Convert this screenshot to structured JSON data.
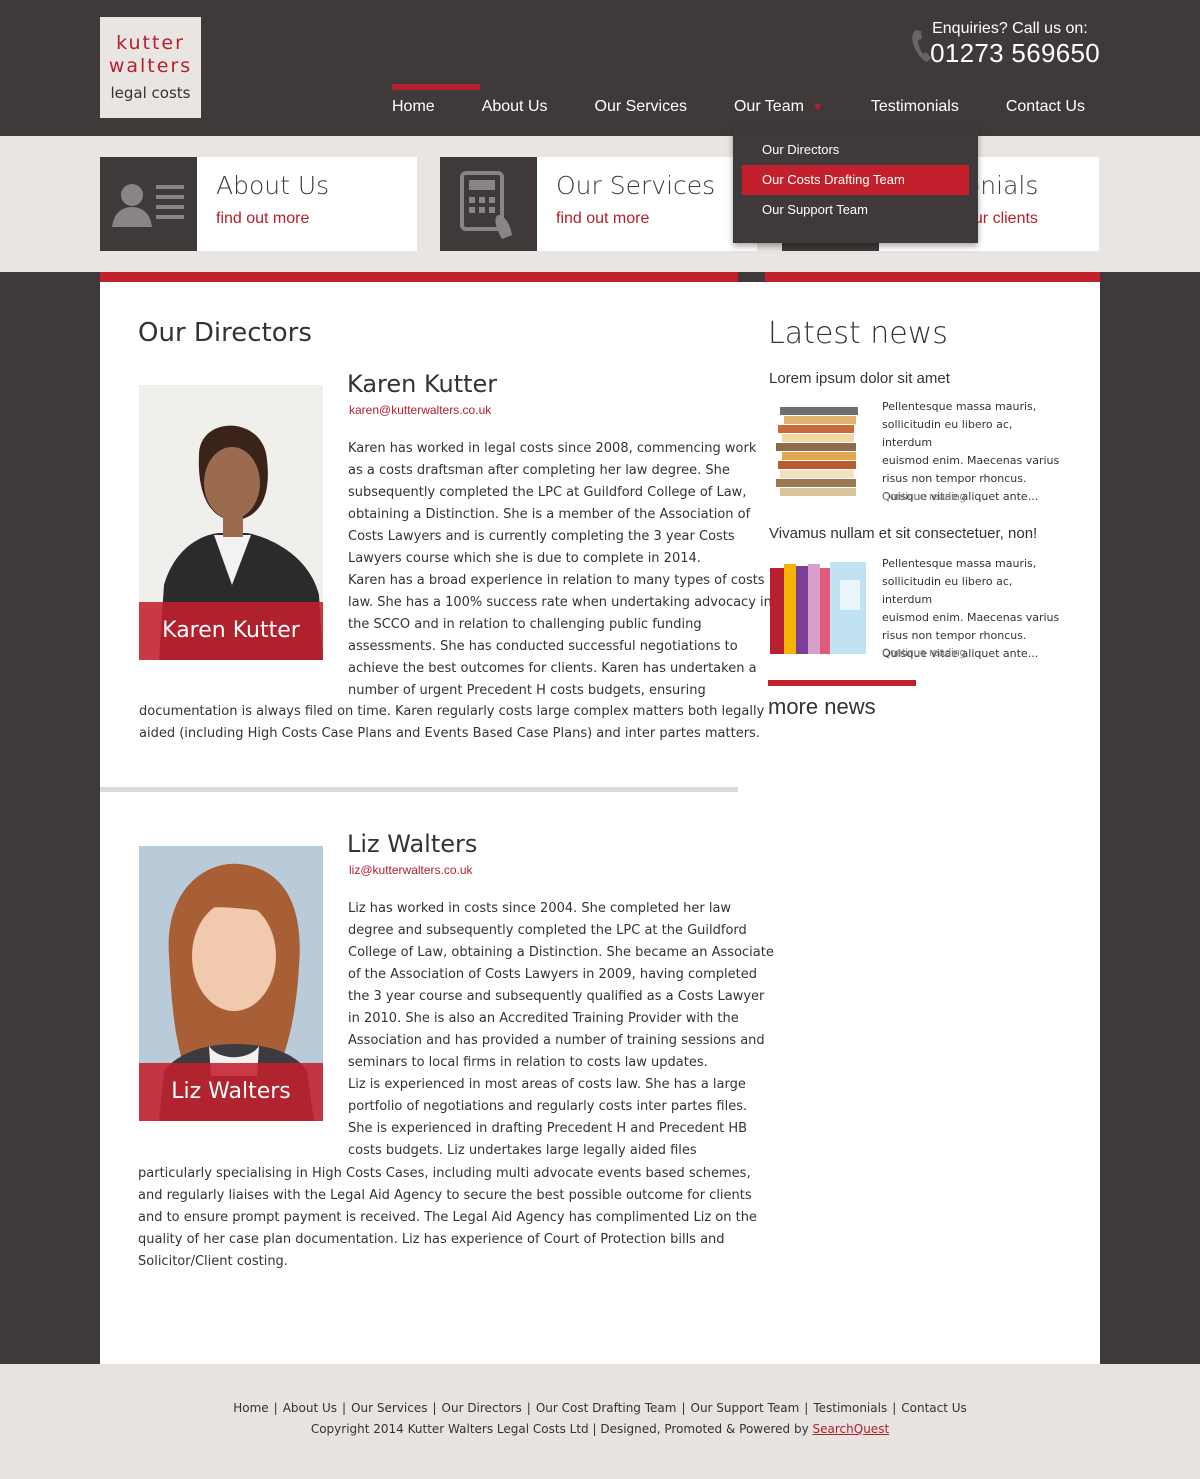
{
  "logo": {
    "line1": "kutter",
    "line2": "walters",
    "line3": "legal costs"
  },
  "header": {
    "enquiries_label": "Enquiries?  Call us on:",
    "phone": "01273 569650"
  },
  "nav": {
    "items": [
      {
        "label": "Home",
        "active": true
      },
      {
        "label": "About Us"
      },
      {
        "label": "Our Services"
      },
      {
        "label": "Our Team",
        "has_dropdown": true
      },
      {
        "label": "Testimonials"
      },
      {
        "label": "Contact Us"
      }
    ]
  },
  "dropdown": {
    "items": [
      {
        "label": "Our Directors"
      },
      {
        "label": "Our Costs Drafting Team",
        "highlighted": true
      },
      {
        "label": "Our Support Team"
      }
    ]
  },
  "features": [
    {
      "title": "About Us",
      "link": "find out more",
      "icon": "person-icon"
    },
    {
      "title": "Our Services",
      "link": "find out more",
      "icon": "calculator-icon"
    },
    {
      "title": "Testimonials",
      "link": "from our clients",
      "icon": "quote-icon",
      "visible_title": "onials",
      "visible_link": "our clients"
    }
  ],
  "main": {
    "heading": "Our Directors",
    "directors": [
      {
        "name": "Karen Kutter",
        "email": "karen@kutterwalters.co.uk",
        "caption": "Karen Kutter",
        "bio_lines": [
          "Karen has worked in legal costs since 2008, commencing work",
          "as a costs draftsman after completing her law degree. She",
          "subsequently completed the LPC at Guildford College of Law,",
          "obtaining a Distinction. She is a member of the Association of",
          "Costs Lawyers and is currently completing the 3 year Costs",
          "Lawyers course which she is due to complete in 2014.",
          "Karen has a broad experience in relation to many types of costs",
          "law. She has a 100% success rate when undertaking advocacy in",
          "the SCCO and in relation to challenging public funding",
          "assessments. She has conducted successful negotiations to",
          "achieve the best outcomes for clients. Karen has undertaken a",
          "number of urgent Precedent H costs budgets, ensuring",
          "documentation is always filed on time. Karen regularly costs large complex matters both legally",
          "aided (including High Costs Case Plans and Events Based Case Plans) and inter partes matters."
        ]
      },
      {
        "name": "Liz Walters",
        "email": "liz@kutterwalters.co.uk",
        "caption": "Liz Walters",
        "bio_lines": [
          "Liz has worked in costs since 2004. She completed her law",
          "degree and subsequently completed the LPC at the Guildford",
          "College of Law, obtaining a Distinction. She became an Associate",
          "of the Association of Costs Lawyers in 2009, having completed",
          "the 3 year course and subsequently qualified as a Costs Lawyer",
          "in 2010. She is also an Accredited Training Provider with the",
          "Association and has provided a number of training sessions and",
          "seminars to local firms in relation to costs law updates.",
          "Liz is experienced in most areas of costs law. She has a large",
          "portfolio of negotiations and regularly costs inter partes files.",
          "She is experienced in drafting Precedent H and Precedent HB",
          "costs budgets. Liz undertakes large legally aided files",
          "particularly specialising in High Costs Cases, including multi advocate events based schemes,",
          "and regularly liaises with the Legal Aid Agency to secure the best possible outcome for clients",
          "and to ensure prompt payment is received. The Legal Aid Agency has complimented Liz on the",
          "quality of her case plan documentation. Liz has experience of Court of Protection bills and",
          "Solicitor/Client costing."
        ]
      }
    ]
  },
  "sidebar": {
    "heading": "Latest news",
    "news": [
      {
        "title": "Lorem ipsum dolor sit amet",
        "text_lines": [
          "Pellentesque massa mauris,",
          "sollicitudin eu libero ac, interdum",
          "euismod enim. Maecenas varius",
          "risus non tempor rhoncus.",
          "Quisque vitae aliquet ante..."
        ],
        "more": "Continue reading",
        "thumb": "books-icon"
      },
      {
        "title": "Vivamus nullam et sit consectetuer, non!",
        "text_lines": [
          "Pellentesque massa mauris,",
          "sollicitudin eu libero ac, interdum",
          "euismod enim. Maecenas varius",
          "risus non tempor rhoncus.",
          "Quisque vitae aliquet ante..."
        ],
        "more": "Continue reading",
        "thumb": "folders-icon"
      }
    ],
    "more_news": "more news"
  },
  "footer": {
    "links": [
      "Home",
      "About Us",
      "Our Services",
      "Our Directors",
      "Our Cost Drafting Team",
      "Our Support Team",
      "Testimonials",
      "Contact Us"
    ],
    "copyright": "Copyright 2014 Kutter Walters Legal Costs Ltd | Designed, Promoted & Powered by",
    "powered_by": "SearchQuest"
  },
  "colors": {
    "brand_red": "#c3202e",
    "dark_bg": "#3f393a",
    "band_bg": "#e8e5e2"
  }
}
